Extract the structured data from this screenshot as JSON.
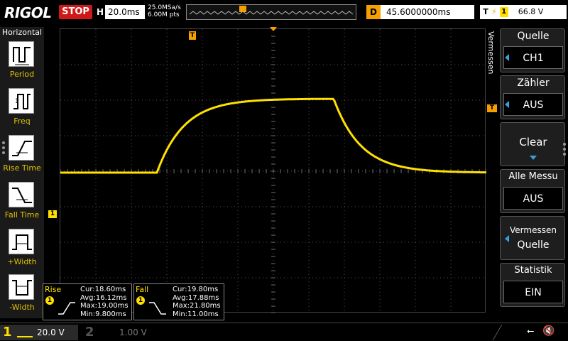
{
  "header": {
    "logo": "RIGOL",
    "run_state": "STOP",
    "timebase_label": "H",
    "timebase_value": "20.0ms",
    "sample_rate": "25.0MSa/s",
    "memory_depth": "6.00M pts",
    "delay_label": "D",
    "delay_value": "45.6000000ms",
    "trigger_label": "T",
    "trigger_source": "1",
    "trigger_level": "66.8 V"
  },
  "left_panel": {
    "title": "Horizontal",
    "items": [
      {
        "label": "Period",
        "icon": "period-icon"
      },
      {
        "label": "Freq",
        "icon": "frequency-icon"
      },
      {
        "label": "Rise Time",
        "icon": "rise-time-icon"
      },
      {
        "label": "Fall Time",
        "icon": "fall-time-icon"
      },
      {
        "label": "+Width",
        "icon": "positive-width-icon"
      },
      {
        "label": "-Width",
        "icon": "negative-width-icon"
      }
    ]
  },
  "right_panel": {
    "title": "Vermessen",
    "items": [
      {
        "label": "Quelle",
        "value": "CH1"
      },
      {
        "label": "Zähler",
        "value": "AUS"
      },
      {
        "label": "Clear"
      },
      {
        "label": "Alle Messu",
        "value": "AUS"
      },
      {
        "line1": "Vermessen",
        "line2": "Quelle"
      },
      {
        "label": "Statistik",
        "value": "EIN"
      }
    ]
  },
  "measurements": [
    {
      "title": "Rise",
      "source": "1",
      "cur": "Cur:18.60ms",
      "avg": "Avg:16.12ms",
      "max": "Max:19.00ms",
      "min": "Min:9.800ms"
    },
    {
      "title": "Fall",
      "source": "1",
      "cur": "Cur:19.80ms",
      "avg": "Avg:17.88ms",
      "max": "Max:21.80ms",
      "min": "Min:11.00ms"
    }
  ],
  "markers": {
    "trigger_position": "T",
    "channel1_ground": "1",
    "trigger_level": "T"
  },
  "channels": [
    {
      "number": "1",
      "scale": "20.0 V",
      "color": "#ffe000"
    },
    {
      "number": "2",
      "scale": "1.00 V",
      "color": "#555555"
    }
  ],
  "colors": {
    "trace": "#ffe000",
    "trigger": "#f5a000",
    "stop": "#d01818",
    "accent": "#39a0e0"
  }
}
